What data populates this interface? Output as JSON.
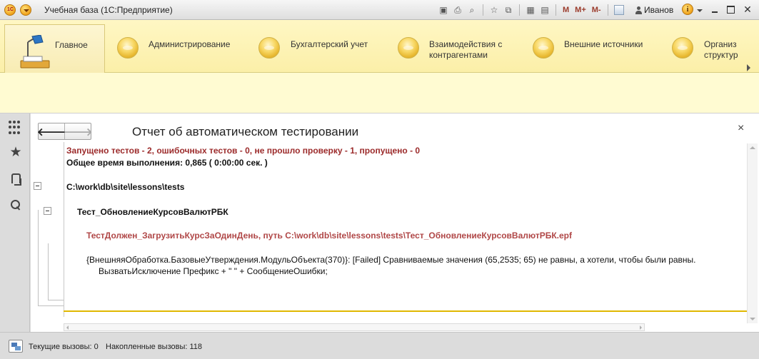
{
  "window": {
    "title": "Учебная база  (1С:Предприятие)",
    "logo_text": "1С",
    "toolbar_m_labels": [
      "M",
      "M+",
      "M-"
    ],
    "user": "Иванов",
    "info_glyph": "i"
  },
  "sections": [
    {
      "label": "Главное",
      "active": true
    },
    {
      "label": "Администрирование"
    },
    {
      "label": "Бухгалтерский учет"
    },
    {
      "label_line1": "Взаимодействия с",
      "label_line2": "контрагентами"
    },
    {
      "label": "Внешние источники"
    },
    {
      "label_line1": "Организ",
      "label_line2": "структур"
    }
  ],
  "form": {
    "title": "Отчет об автоматическом тестировании",
    "back_glyph": "🡐",
    "forward_glyph": "🡒",
    "close_glyph": "×"
  },
  "report": {
    "summary": "Запущено тестов - 2, ошибочных тестов - 0, не прошло проверку - 1, пропущено - 0",
    "elapsed": "Общее время выполнения: 0,865 ( 0:00:00 сек. )",
    "path": "C:\\work\\db\\site\\lessons\\tests",
    "test_name": "Тест_ОбновлениеКурсовВалютРБК",
    "case": "ТестДолжен_ЗагрузитьКурсЗаОдинДень, путь C:\\work\\db\\site\\lessons\\tests\\Тест_ОбновлениеКурсовВалютРБК.epf",
    "error_line1": "{ВнешняяОбработка.БазовыеУтверждения.МодульОбъекта(370)}: [Failed] Сравниваемые значения (65,2535; 65) не равны, а хотели, чтобы были равны.",
    "error_line2": "ВызватьИсключение Префикс + \" \" + СообщениеОшибки;"
  },
  "statusbar": {
    "current_calls": "Текущие вызовы: 0",
    "accumulated_calls": "Накопленные вызовы: 118"
  },
  "colors": {
    "sections_bg": "#fff7c4",
    "summary_text": "#9c2b2b",
    "case_text": "#b04747",
    "divider_accent": "#e0b800"
  }
}
